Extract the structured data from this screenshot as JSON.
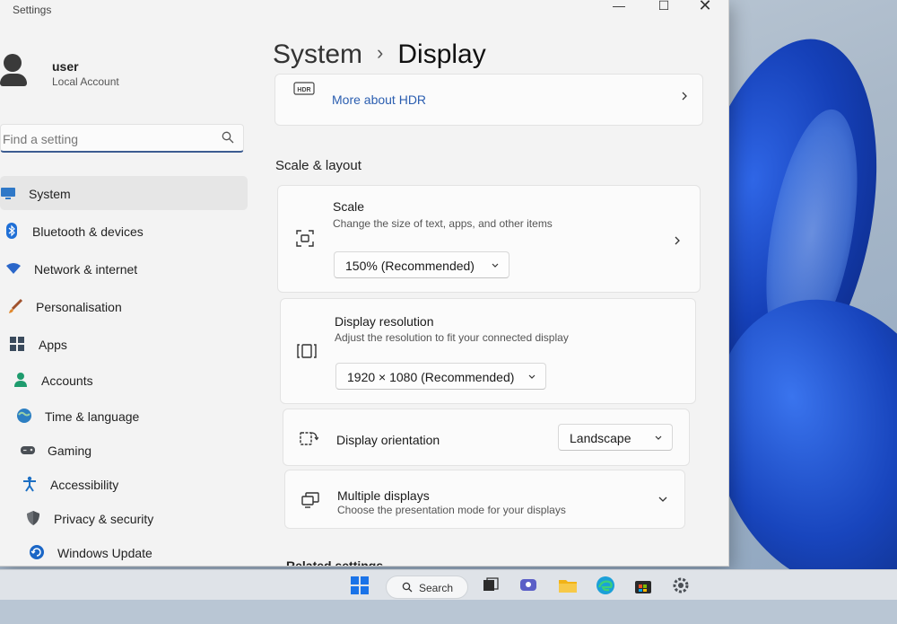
{
  "window": {
    "title": "Settings",
    "minimize": "—",
    "maximize": "☐",
    "close": "✕"
  },
  "user": {
    "name": "user",
    "account_type": "Local Account"
  },
  "search": {
    "placeholder": "Find a setting"
  },
  "nav": [
    {
      "label": "System",
      "icon": "monitor-icon",
      "active": true
    },
    {
      "label": "Bluetooth & devices",
      "icon": "bluetooth-icon"
    },
    {
      "label": "Network & internet",
      "icon": "wifi-icon"
    },
    {
      "label": "Personalisation",
      "icon": "brush-icon"
    },
    {
      "label": "Apps",
      "icon": "apps-icon"
    },
    {
      "label": "Accounts",
      "icon": "person-icon"
    },
    {
      "label": "Time & language",
      "icon": "globe-clock-icon"
    },
    {
      "label": "Gaming",
      "icon": "gamepad-icon"
    },
    {
      "label": "Accessibility",
      "icon": "accessibility-icon"
    },
    {
      "label": "Privacy & security",
      "icon": "shield-icon"
    },
    {
      "label": "Windows Update",
      "icon": "update-icon"
    }
  ],
  "breadcrumb": {
    "parent": "System",
    "separator": "›",
    "current": "Display"
  },
  "hdr": {
    "icon_text": "HDR",
    "link": "More about HDR"
  },
  "scale_layout": {
    "heading": "Scale & layout",
    "scale": {
      "title": "Scale",
      "description": "Change the size of text, apps, and other items",
      "value": "150% (Recommended)"
    },
    "resolution": {
      "title": "Display resolution",
      "description": "Adjust the resolution to fit your connected display",
      "value": "1920 × 1080 (Recommended)"
    },
    "orientation": {
      "title": "Display orientation",
      "value": "Landscape"
    },
    "multiple": {
      "title": "Multiple displays",
      "description": "Choose the presentation mode for your displays"
    }
  },
  "related": {
    "heading": "Related settings"
  },
  "taskbar": {
    "search_label": "Search"
  },
  "colors": {
    "accent": "#3c5c91",
    "wallpaper_blue": "#1845bd"
  }
}
